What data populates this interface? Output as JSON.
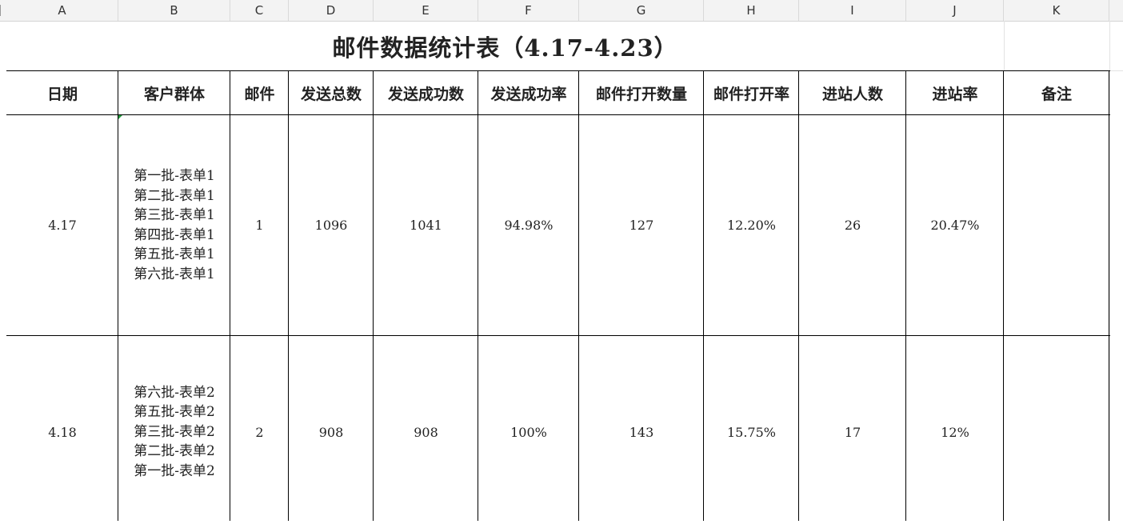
{
  "columns": [
    "A",
    "B",
    "C",
    "D",
    "E",
    "F",
    "G",
    "H",
    "I",
    "J",
    "K"
  ],
  "title": "邮件数据统计表（4.17-4.23）",
  "headers": [
    "日期",
    "客户群体",
    "邮件",
    "发送总数",
    "发送成功数",
    "发送成功率",
    "邮件打开数量",
    "邮件打开率",
    "进站人数",
    "进站率",
    "备注"
  ],
  "rows": [
    {
      "date": "4.17",
      "groups": [
        "第一批-表单1",
        "第二批-表单1",
        "第三批-表单1",
        "第四批-表单1",
        "第五批-表单1",
        "第六批-表单1"
      ],
      "mail": "1",
      "total": "1096",
      "success": "1041",
      "success_rate": "94.98%",
      "opens": "127",
      "open_rate": "12.20%",
      "visitors": "26",
      "visit_rate": "20.47%",
      "note": ""
    },
    {
      "date": "4.18",
      "groups": [
        "第六批-表单2",
        "第五批-表单2",
        "第三批-表单2",
        "第二批-表单2",
        "第一批-表单2"
      ],
      "mail": "2",
      "total": "908",
      "success": "908",
      "success_rate": "100%",
      "opens": "143",
      "open_rate": "15.75%",
      "visitors": "17",
      "visit_rate": "12%",
      "note": ""
    }
  ],
  "colors": {
    "header_bg": "#f3f3f3",
    "border": "#000000",
    "cell_marker": "#1f9a3a"
  }
}
